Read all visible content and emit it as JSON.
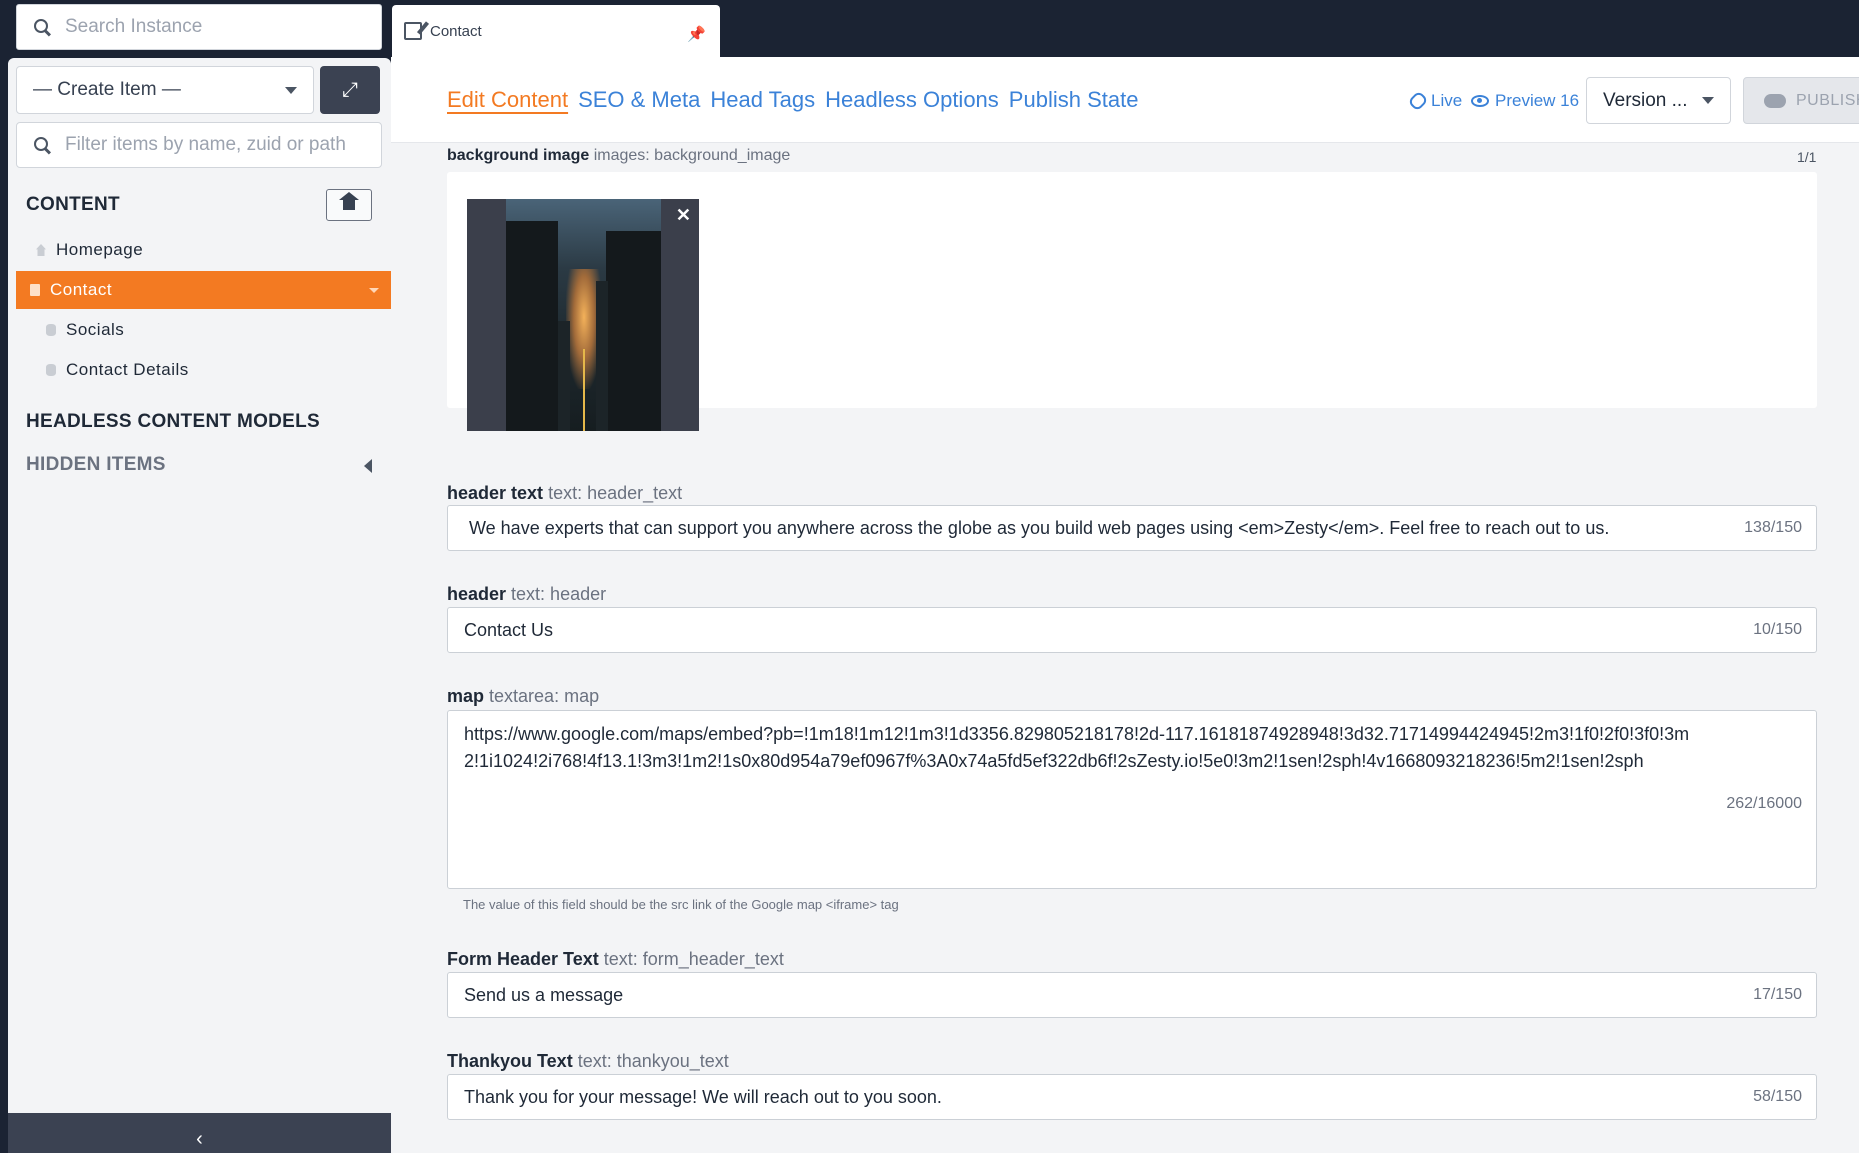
{
  "search_instance": {
    "placeholder": "Search Instance"
  },
  "file_tab": {
    "label": "Contact"
  },
  "sidebar": {
    "create_item": "— Create Item —",
    "filter_placeholder": "Filter items by name, zuid or path",
    "content_title": "CONTENT",
    "items": [
      {
        "label": "Homepage",
        "icon": "home-icon"
      },
      {
        "label": "Contact",
        "icon": "page-icon",
        "active": true
      },
      {
        "label": "Socials",
        "icon": "dataset-icon"
      },
      {
        "label": "Contact Details",
        "icon": "dataset-icon"
      }
    ],
    "headless_title": "HEADLESS CONTENT MODELS",
    "hidden_title": "HIDDEN ITEMS",
    "accent_color": "#f37a22"
  },
  "topbar": {
    "tabs": [
      "Edit Content",
      "SEO & Meta",
      "Head Tags",
      "Headless Options",
      "Publish State"
    ],
    "live": "Live",
    "preview": "Preview 16",
    "version": "Version ...",
    "publish": "PUBLISH"
  },
  "fields": {
    "background_image": {
      "label": "background image",
      "meta": "images: background_image",
      "count": "1/1"
    },
    "header_text": {
      "label": "header text",
      "meta": "text: header_text",
      "value": "We have experts that can support you anywhere across the globe as you build web pages using <em>Zesty</em>. Feel free to reach out to us.",
      "count": "138/150"
    },
    "header": {
      "label": "header",
      "meta": "text: header",
      "value": "Contact Us",
      "count": "10/150"
    },
    "map": {
      "label": "map",
      "meta": "textarea: map",
      "value": "https://www.google.com/maps/embed?pb=!1m18!1m12!1m3!1d3356.829805218178!2d-117.16181874928948!3d32.71714994424945!2m3!1f0!2f0!3f0!3m2!1i1024!2i768!4f13.1!3m3!1m2!1s0x80d954a79ef0967f%3A0x74a5fd5ef322db6f!2sZesty.io!5e0!3m2!1sen!2sph!4v1668093218236!5m2!1sen!2sph",
      "count": "262/16000",
      "help": "The value of this field should be the src link of the Google map <iframe> tag"
    },
    "form_header_text": {
      "label": "Form Header Text",
      "meta": "text: form_header_text",
      "value": "Send us a message",
      "count": "17/150"
    },
    "thankyou_text": {
      "label": "Thankyou Text",
      "meta": "text: thankyou_text",
      "value": "Thank you for your message! We will reach out to you soon.",
      "count": "58/150"
    }
  }
}
